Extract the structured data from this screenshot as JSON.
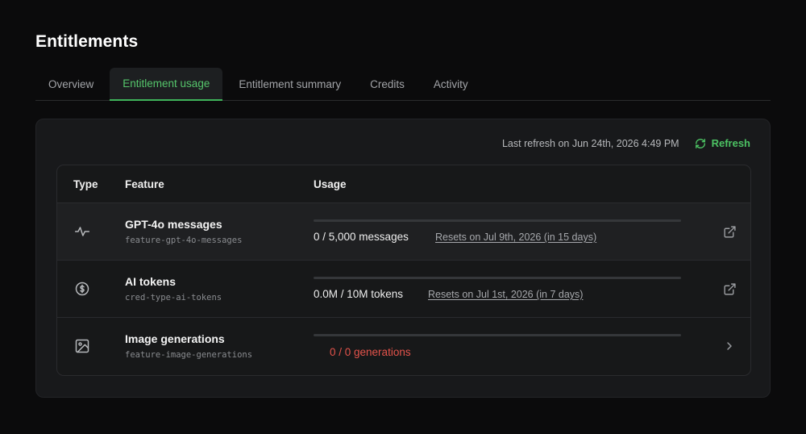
{
  "page": {
    "title": "Entitlements"
  },
  "tabs": [
    {
      "label": "Overview",
      "active": false
    },
    {
      "label": "Entitlement usage",
      "active": true
    },
    {
      "label": "Entitlement summary",
      "active": false
    },
    {
      "label": "Credits",
      "active": false
    },
    {
      "label": "Activity",
      "active": false
    }
  ],
  "refresh": {
    "last_refresh": "Last refresh on Jun 24th, 2026 4:49 PM",
    "button_label": "Refresh"
  },
  "table": {
    "headers": {
      "type": "Type",
      "feature": "Feature",
      "usage": "Usage"
    },
    "rows": [
      {
        "type_icon": "activity-icon",
        "name": "GPT-4o messages",
        "key": "feature-gpt-4o-messages",
        "usage_fraction": 0,
        "used": "0",
        "limit": " / 5,000 messages",
        "reset": "Resets on Jul 9th, 2026 (in 15 days)",
        "action_icon": "external-link-icon"
      },
      {
        "type_icon": "coin-icon",
        "name": "AI tokens",
        "key": "cred-type-ai-tokens",
        "usage_fraction": 0,
        "used": "0.0M",
        "limit": " / 10M tokens",
        "reset": "Resets on Jul 1st, 2026 (in 7 days)",
        "action_icon": "external-link-icon"
      },
      {
        "type_icon": "image-icon",
        "name": "Image generations",
        "key": "feature-image-generations",
        "usage_fraction": 0,
        "used": "0",
        "limit": " / 0 generations",
        "action_icon": "chevron-right-icon"
      }
    ]
  },
  "colors": {
    "accent": "#4cc263",
    "error": "#e5534b",
    "background": "#0b0b0c",
    "card": "#18191b"
  }
}
